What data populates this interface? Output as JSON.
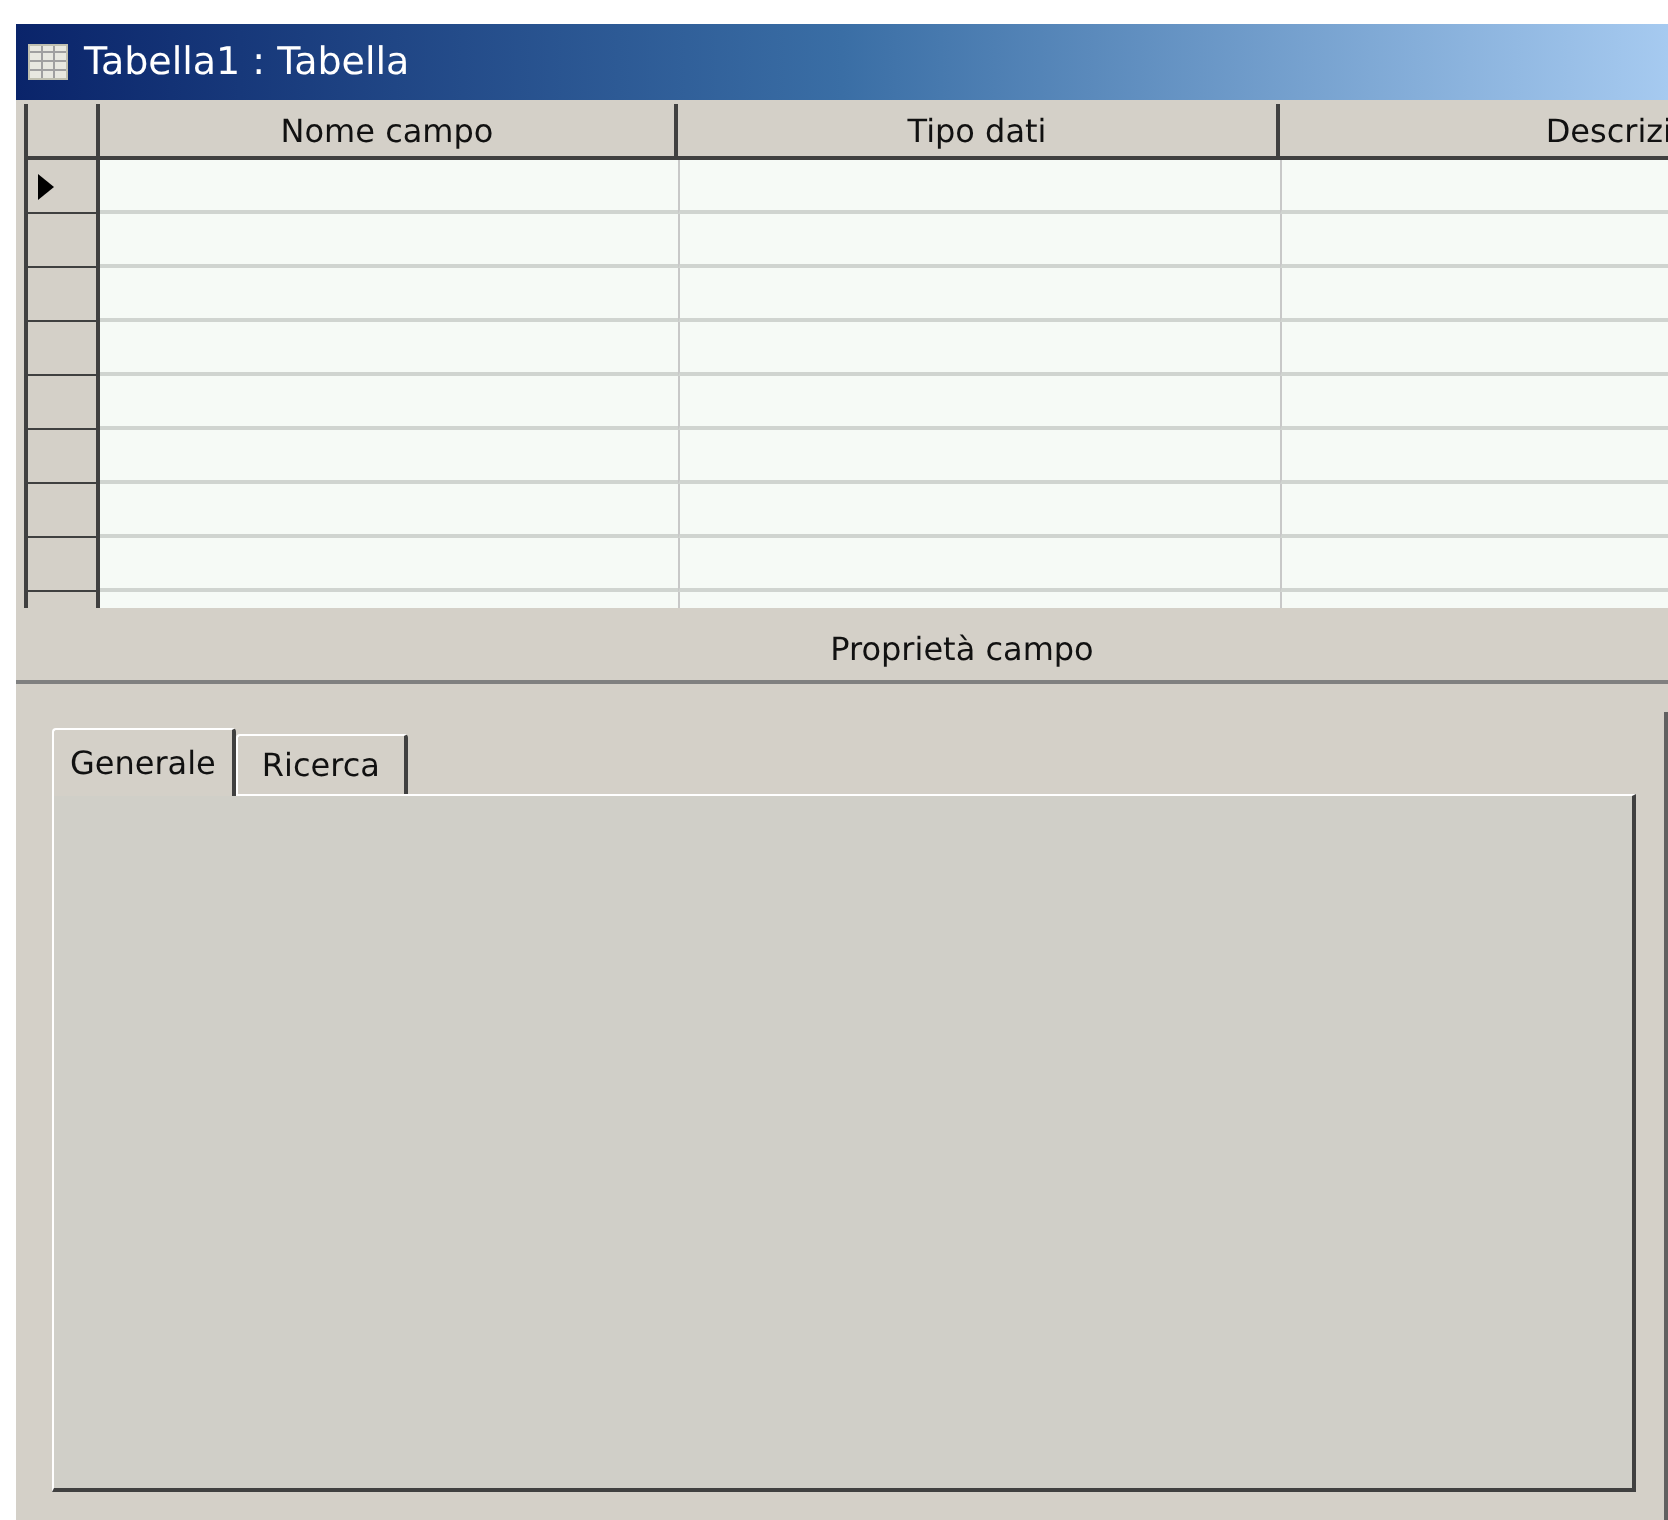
{
  "window": {
    "title": "Tabella1 : Tabella"
  },
  "table": {
    "columns": [
      "Nome campo",
      "Tipo dati",
      "Descrizi"
    ],
    "rows": [
      {
        "current": true
      },
      {
        "current": false
      },
      {
        "current": false
      },
      {
        "current": false
      },
      {
        "current": false
      },
      {
        "current": false
      },
      {
        "current": false
      },
      {
        "current": false
      },
      {
        "current": false
      }
    ]
  },
  "properties": {
    "title": "Proprietà campo",
    "tabs": [
      {
        "label": "Generale",
        "selected": true
      },
      {
        "label": "Ricerca",
        "selected": false
      }
    ]
  }
}
